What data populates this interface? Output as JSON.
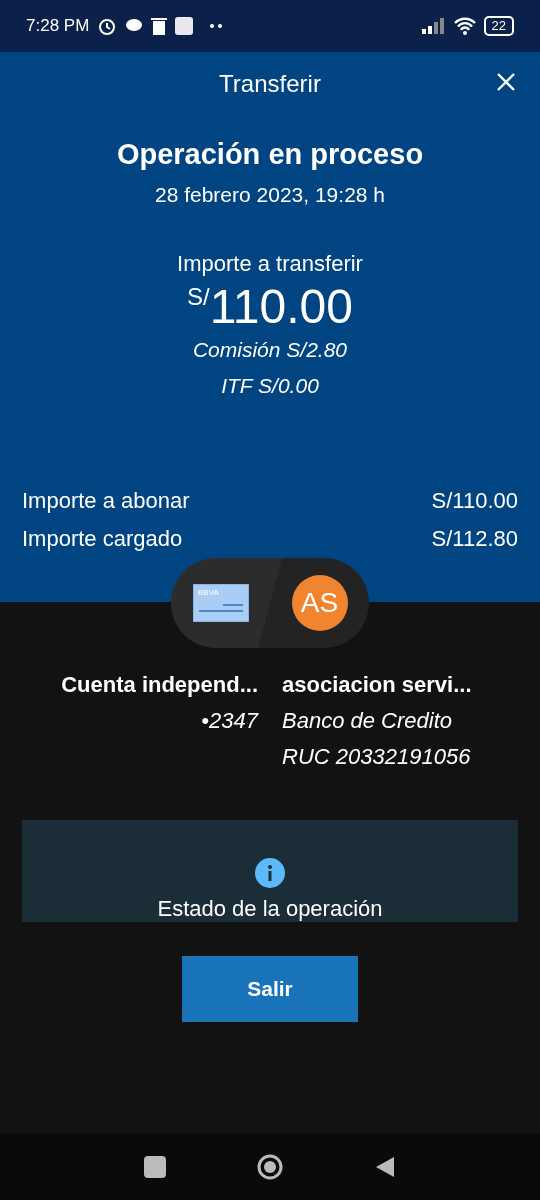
{
  "status_bar": {
    "time": "7:28 PM",
    "battery": "22"
  },
  "header": {
    "title": "Transferir"
  },
  "operation": {
    "title": "Operación en proceso",
    "date": "28 febrero 2023, 19:28 h",
    "amount_label": "Importe a transferir",
    "currency": "S/",
    "amount": "110.00",
    "commission": "Comisión  S/2.80",
    "itf": "ITF  S/0.00"
  },
  "summary": [
    {
      "label": "Importe a abonar",
      "value": "S/110.00"
    },
    {
      "label": "Importe cargado",
      "value": "S/112.80"
    }
  ],
  "parties": {
    "card_logo": "BBVA",
    "avatar": "AS",
    "origin": {
      "name": "Cuenta independ...",
      "account": "•2347"
    },
    "destination": {
      "name": "asociacion servi...",
      "bank": "Banco de Credito",
      "ruc": "RUC 20332191056"
    }
  },
  "status_panel": {
    "title": "Estado de la operación"
  },
  "button": "Salir"
}
